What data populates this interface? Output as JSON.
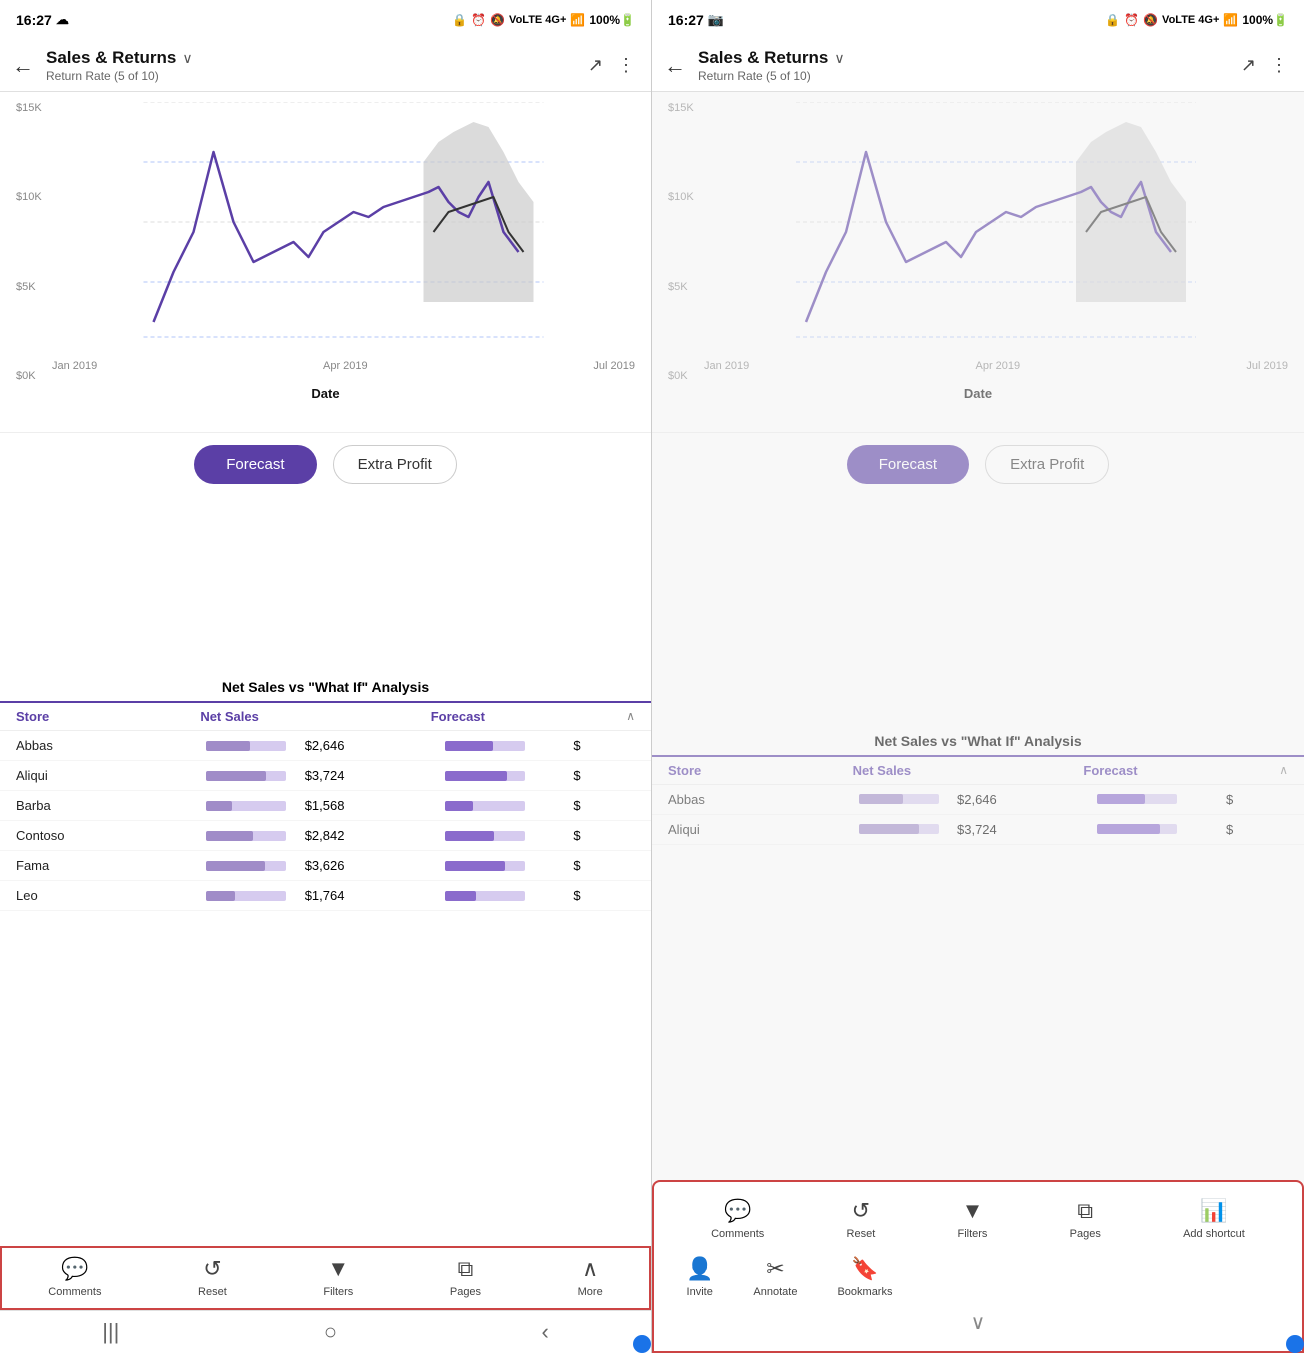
{
  "left": {
    "statusBar": {
      "time": "16:27",
      "icons": "📷 🔔 🔕 VoLTE 4G+ .ill 100%🔋"
    },
    "header": {
      "title": "Sales & Returns",
      "chevron": "∨",
      "subtitle": "Return Rate (5 of 10)",
      "expandIcon": "↗",
      "moreIcon": "⋮"
    },
    "chart": {
      "yLabels": [
        "$15K",
        "$10K",
        "$5K",
        "$0K"
      ],
      "xLabels": [
        "Jan 2019",
        "Apr 2019",
        "Jul 2019"
      ],
      "xAxisTitle": "Date"
    },
    "buttons": {
      "forecast": "Forecast",
      "extraProfit": "Extra Profit"
    },
    "table": {
      "title": "Net Sales vs \"What If\" Analysis",
      "columns": [
        "Store",
        "Net Sales",
        "Forecast"
      ],
      "rows": [
        {
          "store": "Abbas",
          "netSales": "$2,646",
          "barPct": 55
        },
        {
          "store": "Aliqui",
          "netSales": "$3,724",
          "barPct": 75
        },
        {
          "store": "Barba",
          "netSales": "$1,568",
          "barPct": 32
        },
        {
          "store": "Contoso",
          "netSales": "$2,842",
          "barPct": 58
        },
        {
          "store": "Fama",
          "netSales": "$3,626",
          "barPct": 73
        },
        {
          "store": "Leo",
          "netSales": "$1,764",
          "barPct": 36
        }
      ]
    },
    "toolbar": {
      "items": [
        {
          "label": "Comments",
          "icon": "💬"
        },
        {
          "label": "Reset",
          "icon": "↺"
        },
        {
          "label": "Filters",
          "icon": "▼"
        },
        {
          "label": "Pages",
          "icon": "⧉"
        },
        {
          "label": "More",
          "icon": "∧"
        }
      ]
    }
  },
  "right": {
    "statusBar": {
      "time": "16:27",
      "icons": "📷 🔔 🔕 VoLTE 4G+ .ill 100%🔋"
    },
    "header": {
      "title": "Sales & Returns",
      "chevron": "∨",
      "subtitle": "Return Rate (5 of 10)",
      "expandIcon": "↗",
      "moreIcon": "⋮"
    },
    "chart": {
      "yLabels": [
        "$15K",
        "$10K",
        "$5K",
        "$0K"
      ],
      "xLabels": [
        "Jan 2019",
        "Apr 2019",
        "Jul 2019"
      ],
      "xAxisTitle": "Date"
    },
    "buttons": {
      "forecast": "Forecast",
      "extraProfit": "Extra Profit"
    },
    "table": {
      "title": "Net Sales vs \"What If\" Analysis",
      "columns": [
        "Store",
        "Net Sales",
        "Forecast"
      ],
      "rows": [
        {
          "store": "Abbas",
          "netSales": "$2,646",
          "barPct": 55
        },
        {
          "store": "Aliqui",
          "netSales": "$3,724",
          "barPct": 75
        }
      ]
    },
    "expandedToolbar": {
      "row1": [
        {
          "label": "Comments",
          "icon": "💬"
        },
        {
          "label": "Reset",
          "icon": "↺"
        },
        {
          "label": "Filters",
          "icon": "▼"
        },
        {
          "label": "Pages",
          "icon": "⧉"
        },
        {
          "label": "Add shortcut",
          "icon": "📊"
        }
      ],
      "row2": [
        {
          "label": "Invite",
          "icon": "👤"
        },
        {
          "label": "Annotate",
          "icon": "✂"
        },
        {
          "label": "Bookmarks",
          "icon": "🔖"
        }
      ],
      "collapseLabel": "∨"
    }
  }
}
